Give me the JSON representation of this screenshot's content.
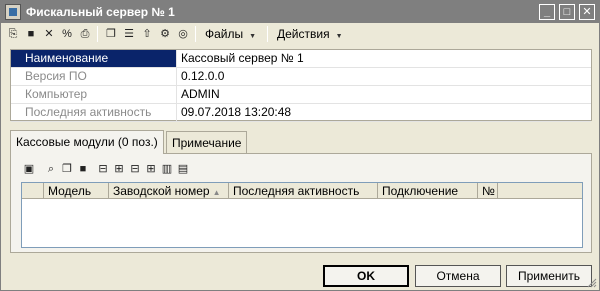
{
  "window": {
    "title": "Фискальный сервер № 1",
    "controls": {
      "minimize": "_",
      "maximize": "□",
      "close": "✕"
    }
  },
  "toolbar": {
    "icons": [
      "save-new-icon",
      "save-icon",
      "delete-icon",
      "percent-icon",
      "print-icon",
      "copy-icon",
      "list-icon",
      "filter-icon",
      "settings-icon",
      "help-icon"
    ],
    "files_menu": "Файлы",
    "actions_menu": "Действия"
  },
  "properties": {
    "rows": [
      {
        "label": "Наименование",
        "value": "Кассовый сервер № 1"
      },
      {
        "label": "Версия ПО",
        "value": "0.12.0.0"
      },
      {
        "label": "Компьютер",
        "value": "ADMIN"
      },
      {
        "label": "Последняя активность",
        "value": "09.07.2018 13:20:48"
      }
    ]
  },
  "tabs": [
    {
      "label": "Кассовые модули (0 поз.)"
    },
    {
      "label": "Примечание"
    }
  ],
  "modules_table": {
    "columns": [
      "Модель",
      "Заводской номер",
      "Последняя активность",
      "Подключение",
      "№"
    ],
    "rows": []
  },
  "buttons": {
    "ok": "OK",
    "cancel": "Отмена",
    "apply": "Применить"
  }
}
